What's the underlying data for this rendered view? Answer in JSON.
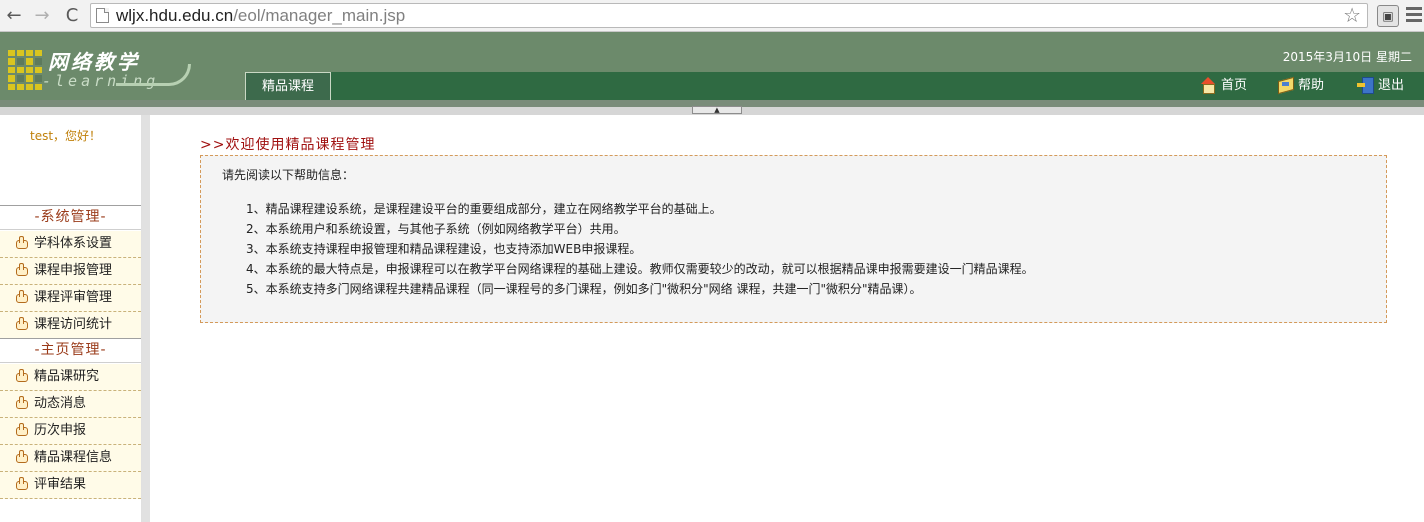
{
  "browser": {
    "url_host": "wljx.hdu.edu.cn",
    "url_path": "/eol/manager_main.jsp",
    "back_icon": "←",
    "forward_icon": "→",
    "reload_icon": "C",
    "star_icon": "☆"
  },
  "header": {
    "logo_cn": "网络教学",
    "logo_en": "-learning",
    "date": "2015年3月10日  星期二",
    "tab_active": "精品课程",
    "links": {
      "home": "首页",
      "help": "帮助",
      "exit": "退出"
    },
    "accent_color": "#2f6a42",
    "header_color": "#6c8a6b"
  },
  "sidebar": {
    "greeting": "test，您好！",
    "sections": [
      {
        "title": "-系统管理-",
        "items": [
          "学科体系设置",
          "课程申报管理",
          "课程评审管理",
          "课程访问统计"
        ]
      },
      {
        "title": "-主页管理-",
        "items": [
          "精品课研究",
          "动态消息",
          "历次申报",
          "精品课程信息",
          "评审结果"
        ]
      }
    ]
  },
  "main": {
    "title": ">>欢迎使用精品课程管理",
    "intro": "请先阅读以下帮助信息：",
    "items": [
      "1、精品课程建设系统，是课程建设平台的重要组成部分，建立在网络教学平台的基础上。",
      "2、本系统用户和系统设置，与其他子系统（例如网络教学平台）共用。",
      "3、本系统支持课程申报管理和精品课程建设，也支持添加WEB申报课程。",
      "4、本系统的最大特点是，申报课程可以在教学平台网络课程的基础上建设。教师仅需要较少的改动，就可以根据精品课申报需要建设一门精品课程。",
      "5、本系统支持多门网络课程共建精品课程（同一课程号的多门课程，例如多门\"微积分\"网络 课程，共建一门\"微积分\"精品课）。"
    ]
  }
}
